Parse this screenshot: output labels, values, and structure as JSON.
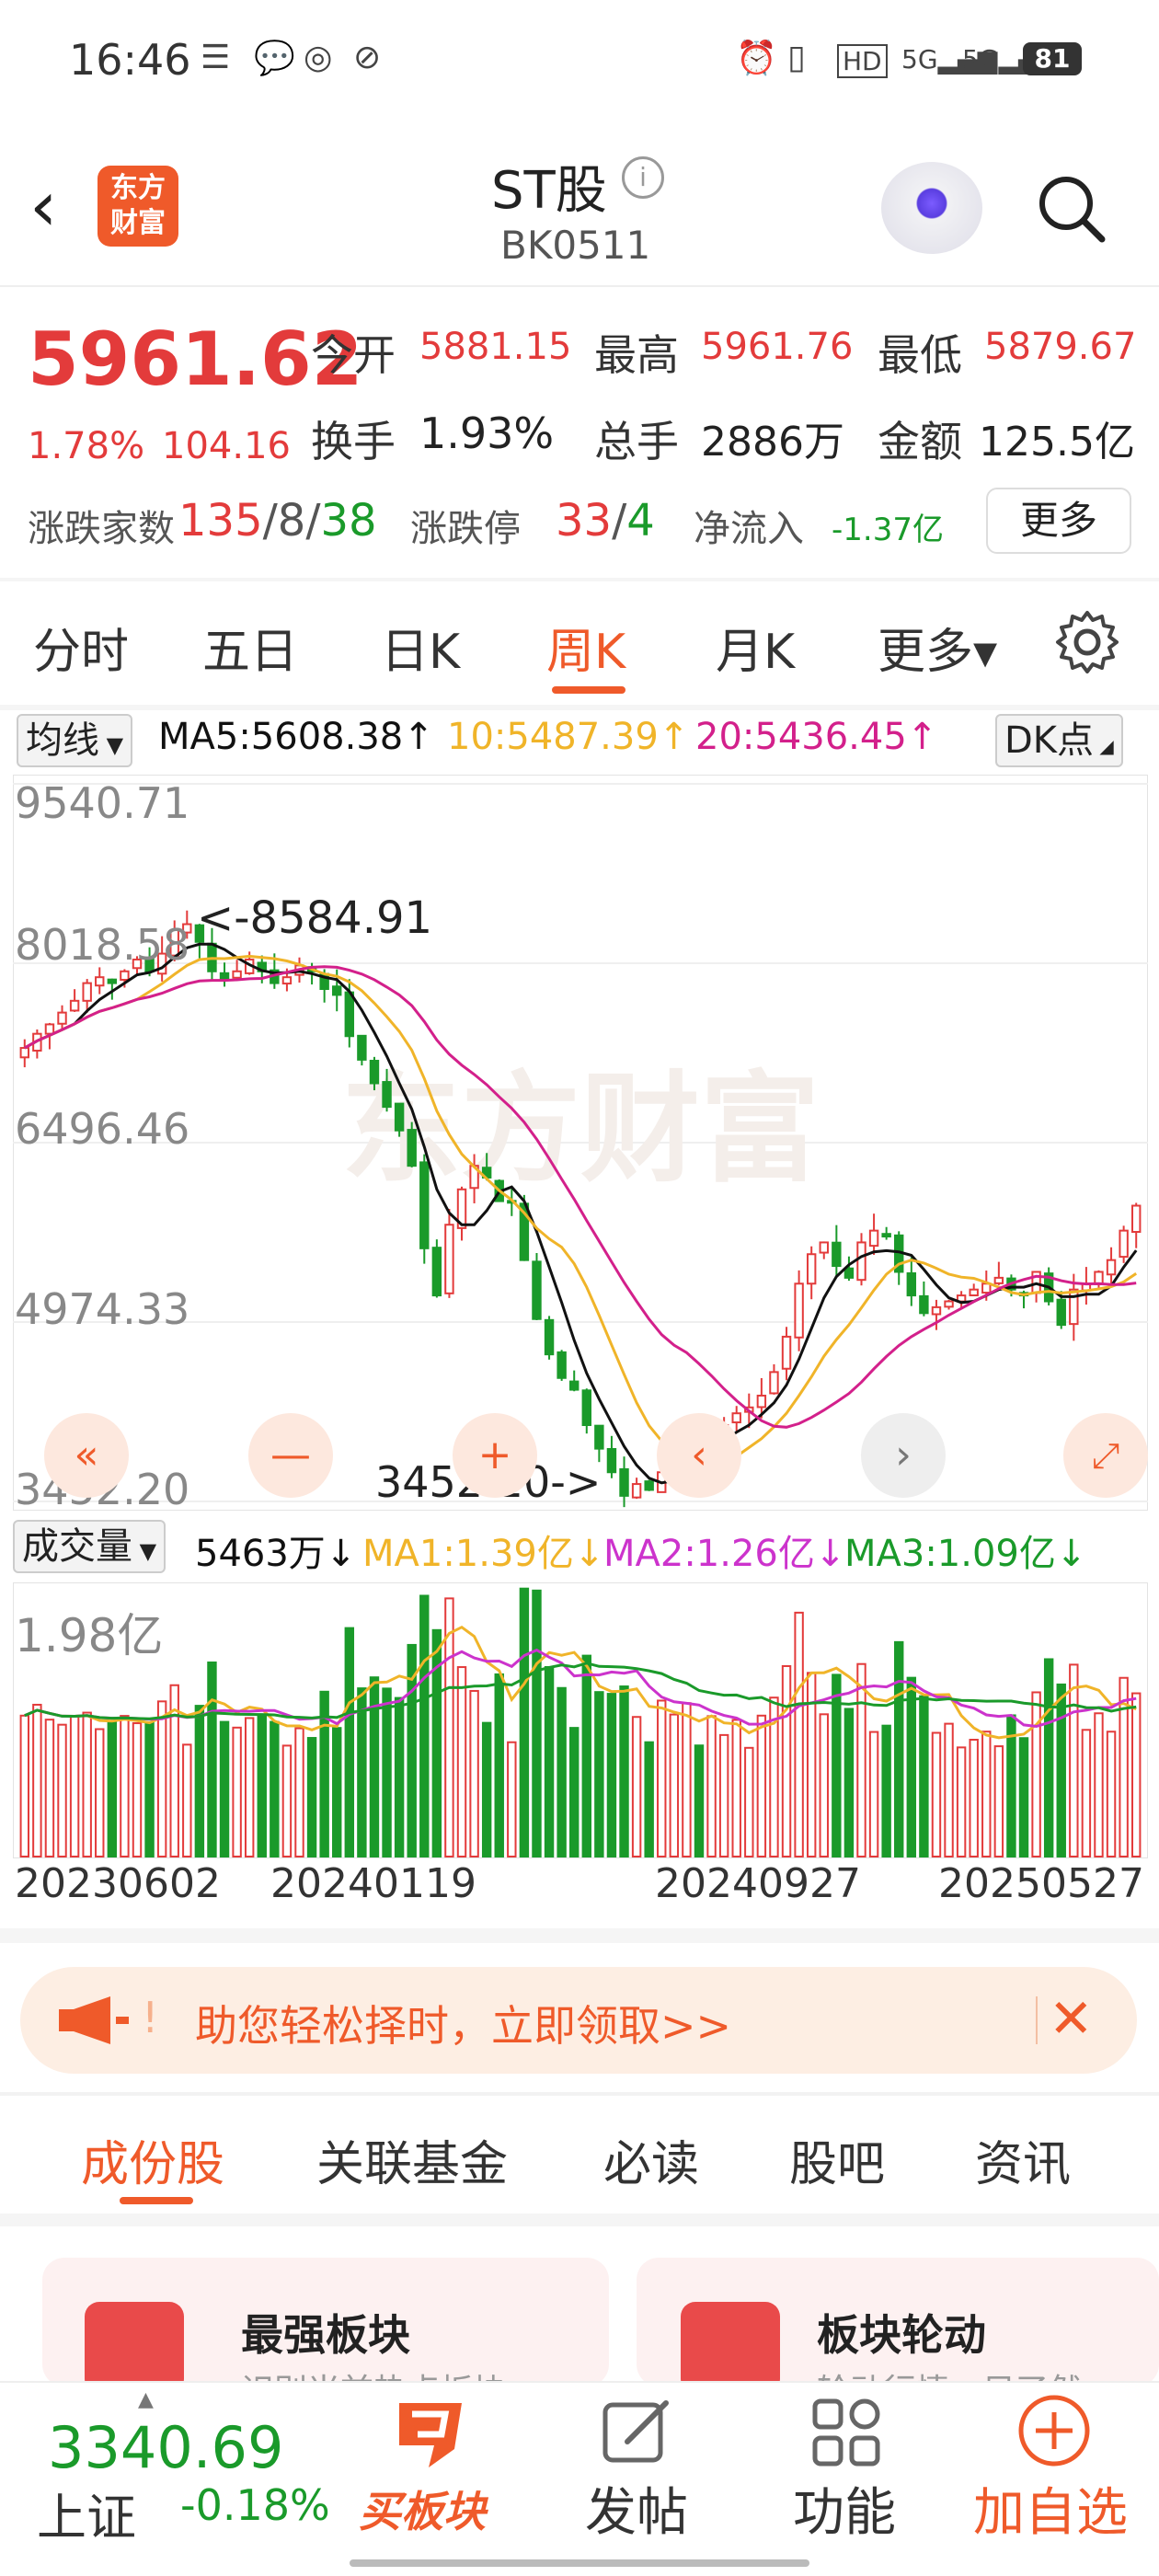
{
  "status_bar": {
    "time": "16:46",
    "battery": "81",
    "left_icons": [
      "sim-icon",
      "chat-icon",
      "weibo-icon",
      "link-icon"
    ],
    "right_icons": [
      "alarm-icon",
      "vibrate-icon",
      "hd-icon",
      "signal-5g-icon",
      "signal-5g-icon"
    ]
  },
  "header": {
    "logo_line1": "东方",
    "logo_line2": "财富",
    "title": "ST股",
    "code": "BK0511",
    "info_glyph": "i"
  },
  "quote": {
    "price": "5961.62",
    "change_pct": "1.78%",
    "change_val": "104.16",
    "open_label": "今开",
    "open": "5881.15",
    "high_label": "最高",
    "high": "5961.76",
    "low_label": "最低",
    "low": "5879.67",
    "turnover_label": "换手",
    "turnover": "1.93%",
    "volume_label": "总手",
    "volume": "2886万",
    "amount_label": "金额",
    "amount": "125.5亿",
    "breadth_label": "涨跌家数",
    "up": "135",
    "flat": "8",
    "down": "38",
    "limit_label": "涨跌停",
    "limit_up": "33",
    "limit_down": "4",
    "netflow_label": "净流入",
    "netflow": "-1.37亿",
    "more": "更多",
    "sep": "/"
  },
  "period_tabs": [
    {
      "label": "分时"
    },
    {
      "label": "五日"
    },
    {
      "label": "日K"
    },
    {
      "label": "周K",
      "active": true
    },
    {
      "label": "月K"
    },
    {
      "label": "更多▾"
    }
  ],
  "chart": {
    "indicator_select": "均线",
    "ma5": "MA5:5608.38↑",
    "ma10": "10:5487.39↑",
    "ma20": "20:5436.45↑",
    "dk_button": "DK点",
    "y_labels": [
      "9540.71",
      "8018.58",
      "6496.46",
      "4974.33",
      "3452.20"
    ],
    "high_marker": "<-8584.91",
    "low_marker": "3452.20->",
    "watermark": "东方财富",
    "volume_select": "成交量",
    "vol_value": "5463万↓",
    "vol_ma1": "MA1:1.39亿↓",
    "vol_ma2": "MA2:1.26亿↓",
    "vol_ma3": "MA3:1.09亿↓",
    "vol_max": "1.98亿",
    "dates": [
      "20230602",
      "20240119",
      "20240927",
      "20250527"
    ],
    "colors": {
      "up": "#e33b3b",
      "down": "#1a9a2a",
      "ma5": "#111111",
      "ma10": "#f0b429",
      "ma20": "#d3208b"
    }
  },
  "chart_data": {
    "type": "candlestick",
    "x_range": [
      "20230602",
      "20250527"
    ],
    "ylim": [
      3452.2,
      9540.71
    ],
    "high": 8584.91,
    "low": 3452.2,
    "close_series": [
      7300,
      7420,
      7500,
      7600,
      7700,
      7850,
      7900,
      7850,
      7950,
      8050,
      7950,
      8100,
      8300,
      8350,
      8200,
      7950,
      7880,
      7950,
      8050,
      7950,
      7850,
      7900,
      8000,
      7950,
      7800,
      7750,
      7400,
      7200,
      7000,
      6800,
      6600,
      6300,
      5600,
      5200,
      5800,
      6100,
      6300,
      6200,
      6000,
      6000,
      5500,
      5000,
      4700,
      4500,
      4400,
      4100,
      3900,
      3700,
      3500,
      3600,
      3550,
      3700,
      3800,
      3950,
      3900,
      4050,
      4100,
      4200,
      4250,
      4350,
      4550,
      4850,
      5300,
      5550,
      5650,
      5450,
      5350,
      5650,
      5750,
      5700,
      5400,
      5200,
      5050,
      5100,
      5150,
      5200,
      5250,
      5300,
      5350,
      5250,
      5200,
      5400,
      5150,
      4950,
      5250,
      5300,
      5400,
      5500,
      5750,
      5961.62
    ],
    "ma_labels": {
      "ma5": 5608.38,
      "ma10": 5487.39,
      "ma20": 5436.45
    },
    "volume_max": "1.98亿",
    "volume_ma": {
      "ma1": "1.39亿",
      "ma2": "1.26亿",
      "ma3": "1.09亿"
    }
  },
  "promo": {
    "prefix": "!",
    "text": "助您轻松择时，立即领取>>",
    "close": "✕"
  },
  "sub_tabs": [
    {
      "label": "成份股",
      "active": true
    },
    {
      "label": "关联基金"
    },
    {
      "label": "必读"
    },
    {
      "label": "股吧"
    },
    {
      "label": "资讯"
    }
  ],
  "cards": [
    {
      "title": "最强板块",
      "subtitle": "识别当前热点板块"
    },
    {
      "title": "板块轮动",
      "subtitle": "轮动行情一目了然"
    }
  ],
  "bottom_nav": {
    "index_value": "3340.69",
    "index_name": "上证",
    "index_change": "-0.18%",
    "buy": "买板块",
    "post": "发帖",
    "func": "功能",
    "watch": "加自选"
  }
}
